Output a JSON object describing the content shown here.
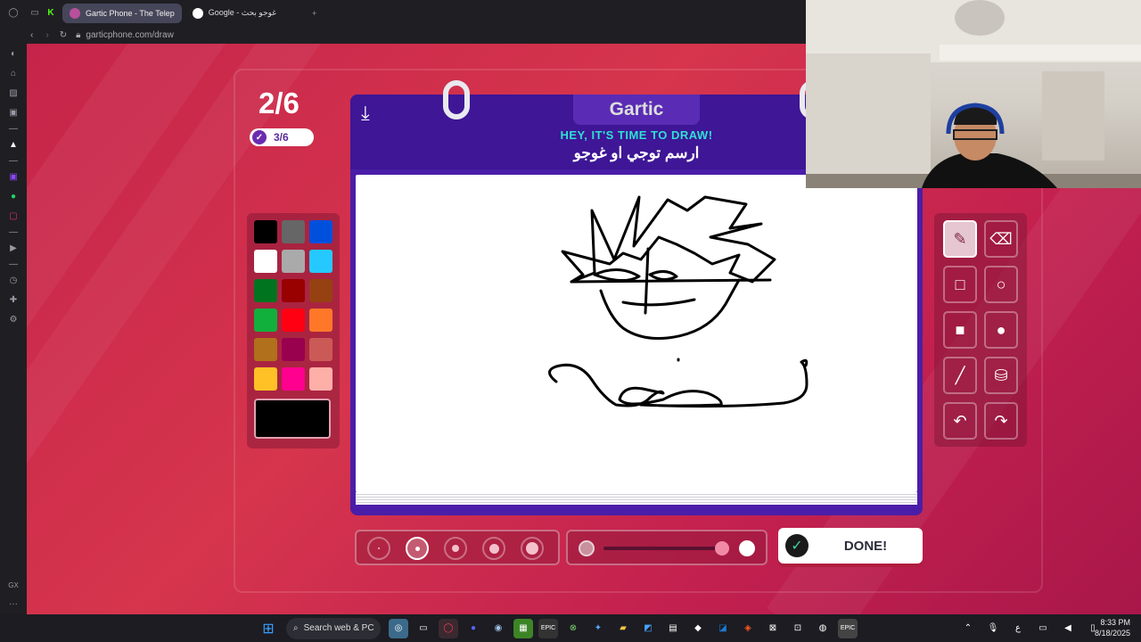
{
  "browser": {
    "tabs": [
      {
        "label": "Gartic Phone - The Telep",
        "active": true,
        "color": "#b8509b"
      },
      {
        "label": "Google - غوجو بحث",
        "active": false,
        "color": "#4285f4"
      }
    ],
    "new_tab_symbol": "+",
    "url": "garticphone.com/draw",
    "sidebar_badge": "GX"
  },
  "game": {
    "round": "2/6",
    "players_done": "3/6",
    "logo": "Gartic",
    "banner_title": "HEY, IT'S TIME TO DRAW!",
    "prompt": "ارسم توجي او غوجو",
    "done_label": "DONE!",
    "palette": [
      "#000000",
      "#666666",
      "#0050dc",
      "#ffffff",
      "#aaaaaa",
      "#26c9ff",
      "#017420",
      "#990000",
      "#964112",
      "#11b03c",
      "#ff0013",
      "#ff7829",
      "#b0701c",
      "#99004e",
      "#cb5a57",
      "#ffc126",
      "#ff008f",
      "#feafa8"
    ],
    "current_color": "#000000",
    "tools": [
      "pen-icon",
      "eraser-icon",
      "square-outline-icon",
      "circle-outline-icon",
      "square-filled-icon",
      "circle-filled-icon",
      "line-icon",
      "fill-bucket-icon",
      "undo-icon",
      "redo-icon"
    ],
    "selected_tool": "pen-icon",
    "brush_sizes": 5,
    "selected_brush_size": 2
  },
  "taskbar": {
    "search_placeholder": "Search web & PC",
    "language": "ع",
    "time": "8:33 PM",
    "date": "8/18/2025"
  }
}
